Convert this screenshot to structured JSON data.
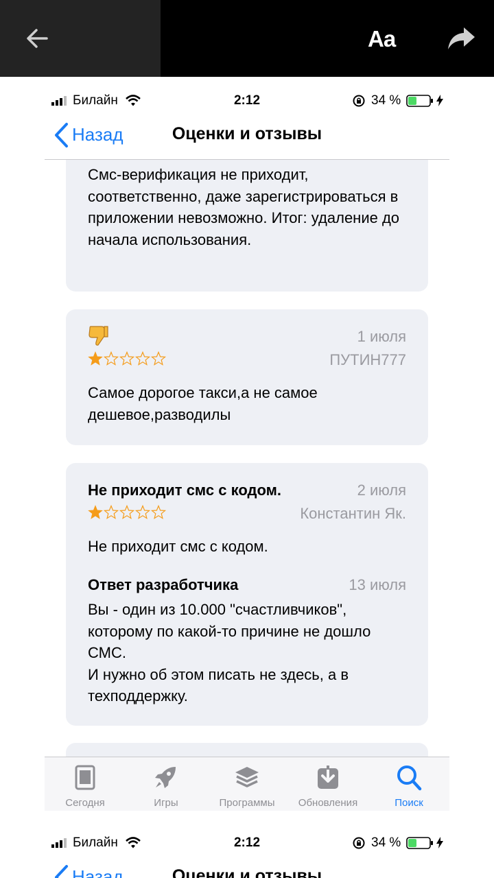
{
  "viewer": {
    "font_button": "Aa",
    "back_icon": "arrow-left-icon",
    "share_icon": "share-arrow-icon"
  },
  "status": {
    "carrier": "Билайн",
    "time": "2:12",
    "battery": "34 %"
  },
  "nav": {
    "back_label": "Назад",
    "title": "Оценки и отзывы"
  },
  "reviews": [
    {
      "body": "Смс-верификация не приходит, соответственно, даже зарегистрироваться в приложении невозможно. Итог: удаление до начала использования."
    },
    {
      "emoji": "👎",
      "date": "1 июля",
      "author": "ПУТИН777",
      "rating": 1,
      "body": "Самое дорогое такси,а не самое дешевое,разводилы"
    },
    {
      "title": "Не приходит смс с кодом.",
      "date": "2 июля",
      "author": "Константин Як.",
      "rating": 1,
      "body": "Не приходит смс с кодом.",
      "response": {
        "label": "Ответ разработчика",
        "date": "13 июля",
        "lines": [
          "Вы - один из 10.000 \"счастливчиков\",",
          "которому по какой-то причине не дошло",
          "СМС.",
          "И нужно об этом писать не здесь, а в",
          "техподдержку."
        ]
      }
    }
  ],
  "tabs": [
    {
      "label": "Сегодня",
      "icon": "today-icon"
    },
    {
      "label": "Игры",
      "icon": "rocket-icon"
    },
    {
      "label": "Программы",
      "icon": "apps-stack-icon"
    },
    {
      "label": "Обновления",
      "icon": "updates-download-icon"
    },
    {
      "label": "Поиск",
      "icon": "search-icon",
      "active": true
    }
  ],
  "colors": {
    "accent": "#1a7cf5",
    "star": "#f59c1a",
    "card_bg": "#eef0f5",
    "muted": "#9a9aa0"
  }
}
